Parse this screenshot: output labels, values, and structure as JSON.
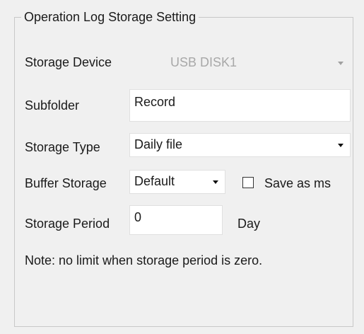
{
  "group": {
    "title": "Operation Log Storage Setting"
  },
  "storage_device": {
    "label": "Storage Device",
    "value": "USB DISK1",
    "icon": "chevron-down-icon"
  },
  "subfolder": {
    "label": "Subfolder",
    "value": "Record"
  },
  "storage_type": {
    "label": "Storage Type",
    "value": "Daily file",
    "icon": "chevron-down-icon"
  },
  "buffer_storage": {
    "label": "Buffer Storage",
    "value": "Default",
    "icon": "chevron-down-icon"
  },
  "save_as_ms": {
    "label": "Save as ms",
    "checked": false
  },
  "storage_period": {
    "label": "Storage Period",
    "value": "0",
    "unit": "Day"
  },
  "note": "Note: no limit when storage period is zero."
}
